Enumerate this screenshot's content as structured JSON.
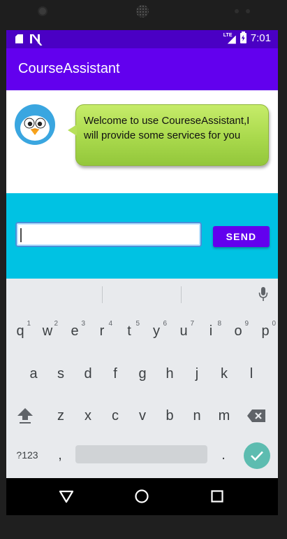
{
  "status_bar": {
    "time": "7:01",
    "network": "LTE",
    "icons": [
      "sd-card-icon",
      "n-notification-icon",
      "signal-icon",
      "battery-charging-icon"
    ]
  },
  "app_bar": {
    "title": "CourseAssistant"
  },
  "chat": {
    "avatar_icon": "bird-avatar-icon",
    "message": "Welcome to use CoureseAssistant,I will provide some services for you"
  },
  "composer": {
    "input_value": "",
    "send_label": "SEND"
  },
  "keyboard": {
    "row1": [
      {
        "key": "q",
        "hint": "1"
      },
      {
        "key": "w",
        "hint": "2"
      },
      {
        "key": "e",
        "hint": "3"
      },
      {
        "key": "r",
        "hint": "4"
      },
      {
        "key": "t",
        "hint": "5"
      },
      {
        "key": "y",
        "hint": "6"
      },
      {
        "key": "u",
        "hint": "7"
      },
      {
        "key": "i",
        "hint": "8"
      },
      {
        "key": "o",
        "hint": "9"
      },
      {
        "key": "p",
        "hint": "0"
      }
    ],
    "row2": [
      "a",
      "s",
      "d",
      "f",
      "g",
      "h",
      "j",
      "k",
      "l"
    ],
    "row3": [
      "z",
      "x",
      "c",
      "v",
      "b",
      "n",
      "m"
    ],
    "symbols_label": "?123",
    "comma": ",",
    "period": "."
  },
  "colors": {
    "status_bar": "#4a00c4",
    "app_bar": "#6200ee",
    "input_panel": "#00c2e3",
    "bubble": "#a9d94c",
    "enter_key": "#5dbcb0"
  }
}
